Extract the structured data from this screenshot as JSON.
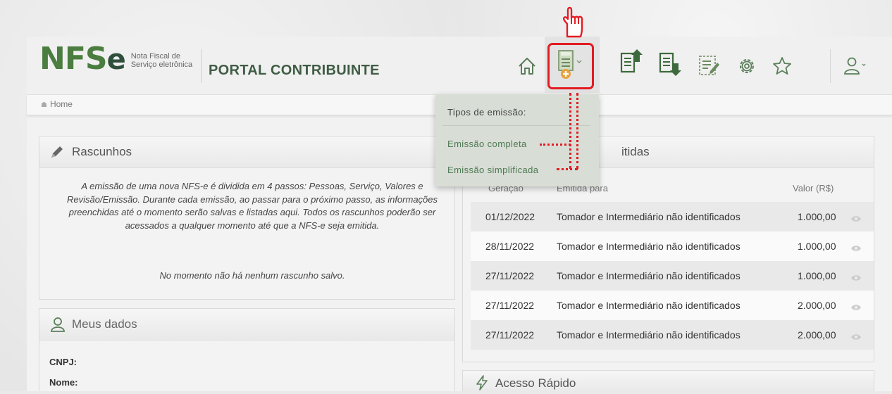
{
  "logo": {
    "brand": "NFS",
    "brand_e": "e",
    "tagline_line1": "Nota Fiscal de",
    "tagline_line2": "Serviço eletrônica"
  },
  "header": {
    "portal_title": "PORTAL CONTRIBUINTE"
  },
  "nav_icons": [
    "home-icon",
    "emit-nfse-icon",
    "upload-document-icon",
    "download-document-icon",
    "edit-document-icon",
    "settings-gear-icon",
    "favorite-star-icon",
    "user-profile-icon"
  ],
  "breadcrumb": {
    "home": "Home"
  },
  "dropdown": {
    "title": "Tipos de emissão:",
    "items": [
      "Emissão completa",
      "Emissão simplificada"
    ]
  },
  "rascunhos": {
    "title": "Rascunhos",
    "text": "A emissão de uma nova NFS-e é dividida em 4 passos: Pessoas, Serviço, Valores e Revisão/Emissão. Durante cada emissão, ao passar para o próximo passo, as informações preenchidas até o momento serão salvas e listadas aqui. Todos os rascunhos poderão ser acessados a qualquer momento até que a NFS-e seja emitida.",
    "empty": "No momento não há nenhum rascunho salvo."
  },
  "meus_dados": {
    "title": "Meus dados",
    "labels": [
      "CNPJ:",
      "Nome:"
    ]
  },
  "emitidas": {
    "title_partial": "itidas",
    "columns": [
      "Geração",
      "Emitida para",
      "Valor (R$)"
    ],
    "rows": [
      {
        "date": "01/12/2022",
        "to": "Tomador e Intermediário não identificados",
        "value": "1.000,00"
      },
      {
        "date": "28/11/2022",
        "to": "Tomador e Intermediário não identificados",
        "value": "1.000,00"
      },
      {
        "date": "27/11/2022",
        "to": "Tomador e Intermediário não identificados",
        "value": "1.000,00"
      },
      {
        "date": "27/11/2022",
        "to": "Tomador e Intermediário não identificados",
        "value": "2.000,00"
      },
      {
        "date": "27/11/2022",
        "to": "Tomador e Intermediário não identificados",
        "value": "2.000,00"
      }
    ]
  },
  "acesso_rapido": {
    "title": "Acesso Rápido"
  },
  "colors": {
    "highlight": "#e31b23",
    "brand_green": "#4a7d3f",
    "title_green": "#3f5c44",
    "link_green": "#4e7a53"
  }
}
